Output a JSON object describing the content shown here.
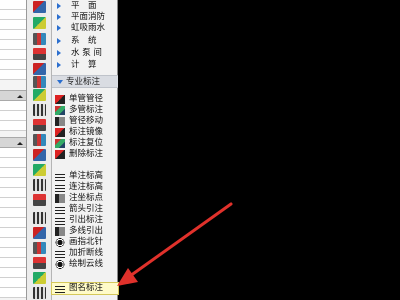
{
  "menu": {
    "categories": [
      {
        "label": "平　面",
        "icon": "triangle-right-icon"
      },
      {
        "label": "平面消防",
        "icon": "triangle-right-icon"
      },
      {
        "label": "虹吸雨水",
        "icon": "triangle-right-icon"
      },
      {
        "label": "系　统",
        "icon": "triangle-right-icon"
      },
      {
        "label": "水 泵 间",
        "icon": "triangle-right-icon"
      },
      {
        "label": "计　算",
        "icon": "triangle-right-icon"
      }
    ],
    "section_label": "专业标注",
    "items": [
      {
        "label": "单管管径",
        "icon": "pipe-diameter-icon"
      },
      {
        "label": "多管标注",
        "icon": "multi-pipe-icon"
      },
      {
        "label": "管径移动",
        "icon": "diameter-move-icon"
      },
      {
        "label": "标注镜像",
        "icon": "mirror-icon"
      },
      {
        "label": "标注复位",
        "icon": "reset-icon"
      },
      {
        "label": "删除标注",
        "icon": "delete-label-icon"
      },
      {
        "label": "单注标高",
        "icon": "elevation-icon"
      },
      {
        "label": "连注标高",
        "icon": "multi-elevation-icon"
      },
      {
        "label": "注坐标点",
        "icon": "coordinate-icon"
      },
      {
        "label": "箭头引注",
        "icon": "arrow-leader-icon"
      },
      {
        "label": "引出标注",
        "icon": "leader-icon"
      },
      {
        "label": "多线引出",
        "icon": "multi-leader-icon"
      },
      {
        "label": "画指北针",
        "icon": "compass-icon"
      },
      {
        "label": "加折断线",
        "icon": "break-line-icon"
      },
      {
        "label": "绘制云线",
        "icon": "cloud-line-icon"
      },
      {
        "label": "图名标注",
        "icon": "drawing-title-icon"
      }
    ],
    "selected_item": "图名标注"
  },
  "colors": {
    "canvas_background": "#000000",
    "annotation_arrow": "#e0312b",
    "menu_arrow": "#2b6fcf",
    "selected_item_bg": "#fffbc8"
  }
}
